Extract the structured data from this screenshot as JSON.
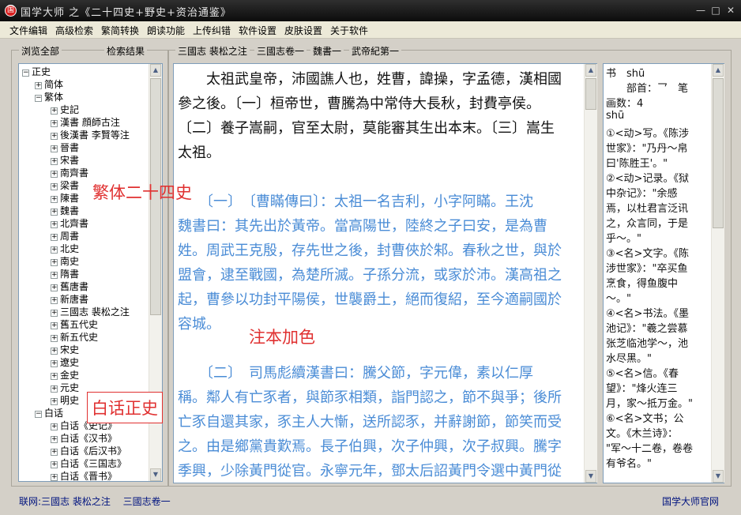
{
  "window": {
    "title": "国学大师 之《二十四史+野史+资治通鉴》",
    "app_icon": "国",
    "min": "—",
    "max": "□",
    "close": "✕"
  },
  "menu": [
    "文件编辑",
    "高级检索",
    "繁简转换",
    "朗读功能",
    "上传纠错",
    "软件设置",
    "皮肤设置",
    "关于软件"
  ],
  "left_panel": {
    "tab_browse": "浏览全部",
    "tab_results": "检索结果",
    "tree": [
      {
        "label": "正史",
        "level": 0,
        "box": "−"
      },
      {
        "label": "简体",
        "level": 1,
        "box": "+"
      },
      {
        "label": "繁体",
        "level": 1,
        "box": "−"
      },
      {
        "label": "史記",
        "level": 2,
        "box": "+"
      },
      {
        "label": "漢書 顔師古注",
        "level": 2,
        "box": "+"
      },
      {
        "label": "後漢書 李賢等注",
        "level": 2,
        "box": "+"
      },
      {
        "label": "晉書",
        "level": 2,
        "box": "+"
      },
      {
        "label": "宋書",
        "level": 2,
        "box": "+"
      },
      {
        "label": "南齊書",
        "level": 2,
        "box": "+"
      },
      {
        "label": "梁書",
        "level": 2,
        "box": "+"
      },
      {
        "label": "陳書",
        "level": 2,
        "box": "+"
      },
      {
        "label": "魏書",
        "level": 2,
        "box": "+"
      },
      {
        "label": "北齊書",
        "level": 2,
        "box": "+"
      },
      {
        "label": "周書",
        "level": 2,
        "box": "+"
      },
      {
        "label": "北史",
        "level": 2,
        "box": "+"
      },
      {
        "label": "南史",
        "level": 2,
        "box": "+"
      },
      {
        "label": "隋書",
        "level": 2,
        "box": "+"
      },
      {
        "label": "舊唐書",
        "level": 2,
        "box": "+"
      },
      {
        "label": "新唐書",
        "level": 2,
        "box": "+"
      },
      {
        "label": "三國志 裴松之注",
        "level": 2,
        "box": "+"
      },
      {
        "label": "舊五代史",
        "level": 2,
        "box": "+"
      },
      {
        "label": "新五代史",
        "level": 2,
        "box": "+"
      },
      {
        "label": "宋史",
        "level": 2,
        "box": "+"
      },
      {
        "label": "遼史",
        "level": 2,
        "box": "+"
      },
      {
        "label": "金史",
        "level": 2,
        "box": "+"
      },
      {
        "label": "元史",
        "level": 2,
        "box": "+"
      },
      {
        "label": "明史",
        "level": 2,
        "box": "+"
      },
      {
        "label": "白话",
        "level": 1,
        "box": "−"
      },
      {
        "label": "白话《史记》",
        "level": 2,
        "box": "+"
      },
      {
        "label": "白话《汉书》",
        "level": 2,
        "box": "+"
      },
      {
        "label": "白话《后汉书》",
        "level": 2,
        "box": "+"
      },
      {
        "label": "白话《三国志》",
        "level": 2,
        "box": "+"
      },
      {
        "label": "白话《晋书》",
        "level": 2,
        "box": "+"
      }
    ]
  },
  "breadcrumb": [
    "三國志 裴松之注",
    "三國志卷一",
    "魏書一",
    "武帝紀第一"
  ],
  "content": {
    "lines": [
      {
        "text": "　　太祖武皇帝，沛國譙人也，姓曹，諱操，字孟德，漢相國",
        "kind": "main"
      },
      {
        "text": "參之後。〔一〕桓帝世，曹騰為中常侍大長秋，封費亭侯。",
        "kind": "main"
      },
      {
        "text": "〔二〕養子嵩嗣，官至太尉，莫能審其生出本末。〔三〕嵩生",
        "kind": "main"
      },
      {
        "text": "太祖。",
        "kind": "main"
      },
      {
        "text": "",
        "kind": "blank"
      },
      {
        "text": "　　〔一〕　〔曹瞞傳曰〕：太祖一名吉利，小字阿瞞。王沈",
        "kind": "note"
      },
      {
        "text": "魏書曰：其先出於黃帝。當高陽世，陸終之子曰安，是為曹",
        "kind": "note"
      },
      {
        "text": "姓。周武王克殷，存先世之後，封曹俠於邾。春秋之世，與於",
        "kind": "note"
      },
      {
        "text": "盟會，逮至戰國，為楚所滅。子孫分流，或家於沛。漢高祖之",
        "kind": "note"
      },
      {
        "text": "起，曹參以功封平陽侯，世襲爵土，絕而復紹，至今適嗣國於",
        "kind": "note"
      },
      {
        "text": "容城。",
        "kind": "note"
      },
      {
        "text": "",
        "kind": "blank"
      },
      {
        "text": "　　〔二〕　司馬彪續漢書曰：騰父節，字元偉，素以仁厚",
        "kind": "note"
      },
      {
        "text": "稱。鄰人有亡豕者，與節豕相類，詣門認之，節不與爭；後所",
        "kind": "note"
      },
      {
        "text": "亡豕自還其家，豕主人大慚，送所認豕，并辭謝節，節笑而受",
        "kind": "note"
      },
      {
        "text": "之。由是鄉黨貴歎焉。長子伯興，次子仲興，次子叔興。騰字",
        "kind": "note"
      },
      {
        "text": "季興，少除黃門從官。永寧元年，鄧太后詔黃門令選中黃門從",
        "kind": "note"
      }
    ]
  },
  "dictionary": {
    "lines": [
      "书　shū",
      "　　部首：乛　笔",
      "画数：4",
      "shū",
      "①<动>写。《陈涉",
      "世家》：\"乃丹～帛",
      "曰'陈胜王'。\"",
      "②<动>记录。《狱",
      "中杂记》：\"余感",
      "焉，以杜君言泛讯",
      "之，众言同，于是",
      "乎～。\"",
      "③<名>文字。《陈",
      "涉世家》：\"卒买鱼",
      "烹食，得鱼腹中",
      "～。\"",
      "④<名>书法。《墨",
      "池记》：\"羲之尝慕",
      "张芝临池学～，池",
      "水尽黑。\"",
      "⑤<名>信。《春",
      "望》：\"烽火连三",
      "月，家～抵万金。\"",
      "⑥<名>文书；公",
      "文。《木兰诗》：",
      "\"军～十二卷，卷卷",
      "有爷名。\""
    ]
  },
  "annotations": {
    "fanti": "繁体二十四史",
    "note_color": "注本加色",
    "baihua": "白话正史"
  },
  "status": {
    "left": "联网:三國志 裴松之注　 三國志卷一",
    "right": "国学大师官网"
  },
  "colors": {
    "note_text": "#4a8cd6",
    "annotation": "#e03030",
    "status_text": "#00137f"
  }
}
